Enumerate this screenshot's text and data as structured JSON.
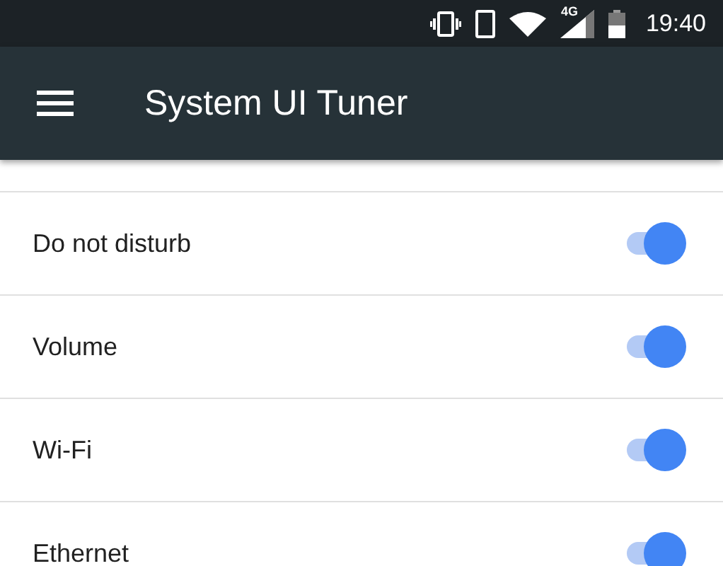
{
  "status_bar": {
    "network": "4G",
    "time": "19:40"
  },
  "app_bar": {
    "title": "System UI Tuner"
  },
  "settings": [
    {
      "label": "Do not disturb",
      "on": true
    },
    {
      "label": "Volume",
      "on": true
    },
    {
      "label": "Wi-Fi",
      "on": true
    },
    {
      "label": "Ethernet",
      "on": true
    }
  ]
}
